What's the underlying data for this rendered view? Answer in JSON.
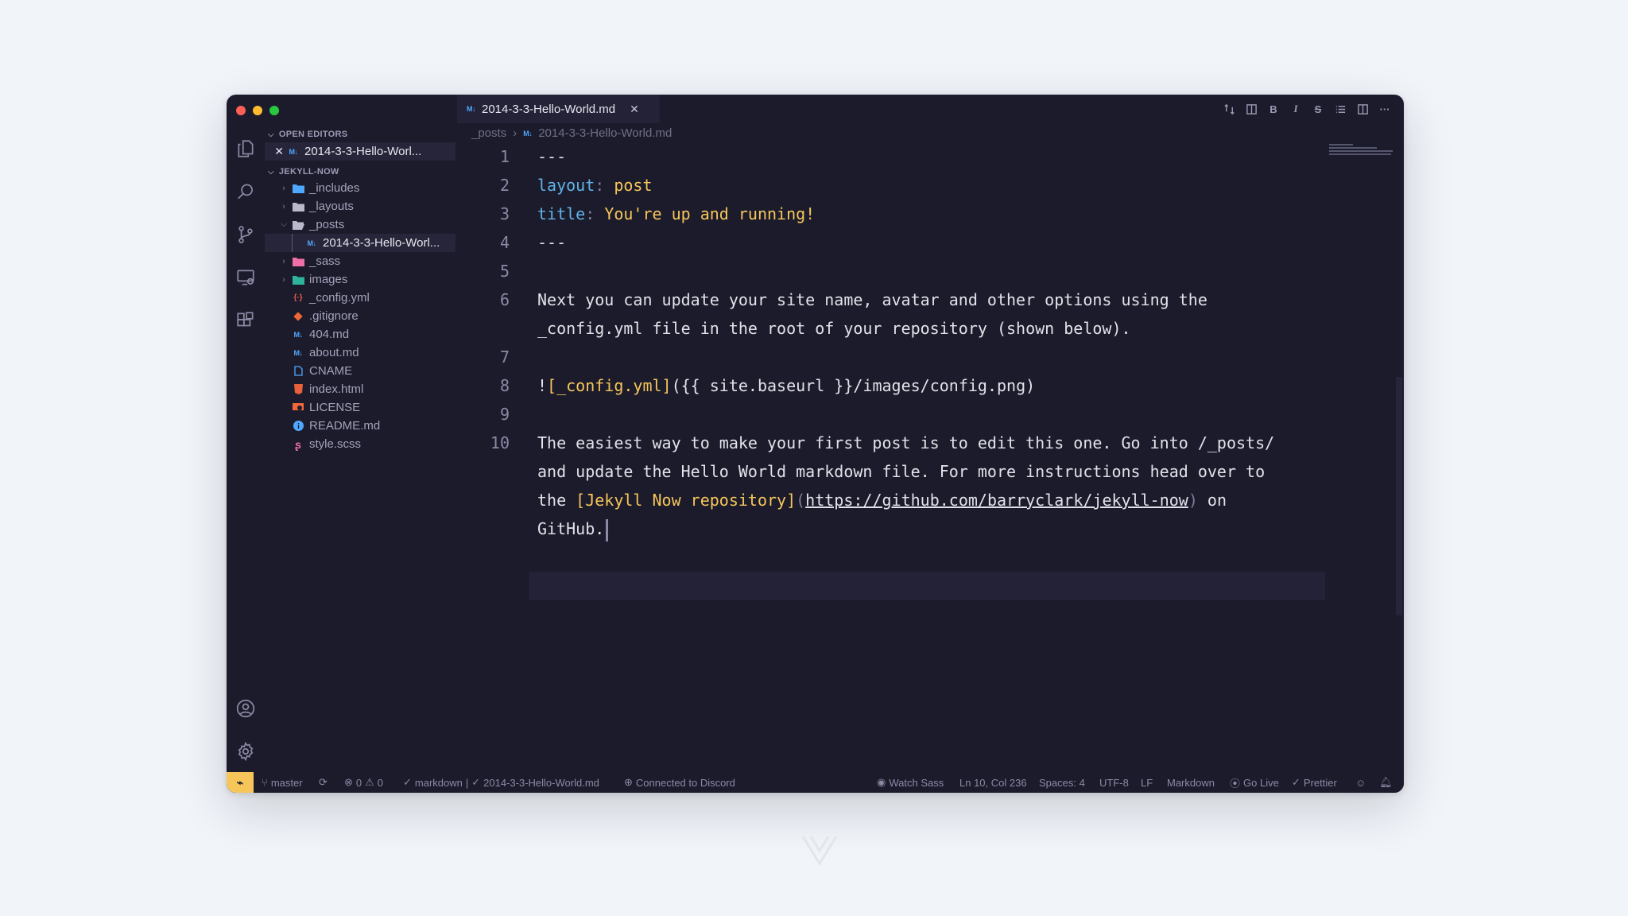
{
  "sidebar": {
    "more_label": "···",
    "open_editors": {
      "title": "OPEN EDITORS",
      "items": [
        {
          "label": "2014-3-3-Hello-Worl..."
        }
      ]
    },
    "project": {
      "title": "JEKYLL-NOW",
      "items": [
        {
          "label": "_includes"
        },
        {
          "label": "_layouts"
        },
        {
          "label": "_posts"
        },
        {
          "label": "2014-3-3-Hello-Worl..."
        },
        {
          "label": "_sass"
        },
        {
          "label": "images"
        },
        {
          "label": "_config.yml"
        },
        {
          "label": ".gitignore"
        },
        {
          "label": "404.md"
        },
        {
          "label": "about.md"
        },
        {
          "label": "CNAME"
        },
        {
          "label": "index.html"
        },
        {
          "label": "LICENSE"
        },
        {
          "label": "README.md"
        },
        {
          "label": "style.scss"
        }
      ]
    }
  },
  "tab": {
    "label": "2014-3-3-Hello-World.md",
    "badge": "M↓"
  },
  "toolbar": {
    "bold": "B",
    "italic": "I",
    "strike": "S",
    "more": "···"
  },
  "breadcrumb": {
    "folder": "_posts",
    "sep": "›",
    "file": "2014-3-3-Hello-World.md"
  },
  "editor": {
    "line_numbers": [
      "1",
      "2",
      "3",
      "4",
      "5",
      "6",
      "7",
      "8",
      "9",
      "10"
    ],
    "l1": "---",
    "l2_key": "layout",
    "l2_colon": ": ",
    "l2_val": "post",
    "l3_key": "title",
    "l3_colon": ": ",
    "l3_val": "You're up and running!",
    "l4": "---",
    "l6a": "Next you can update your site name, avatar and other options using the",
    "l6b": "_config.yml file in the root of your repository (shown below).",
    "l8_bang": "!",
    "l8_alt": "[_config.yml]",
    "l8_rest": "({{ site.baseurl }}/images/config.png)",
    "l10a": "The easiest way to make your first post is to edit this one. Go into /_posts/",
    "l10b": "and update the Hello World markdown file. For more instructions head over to",
    "l10c_pre": "the ",
    "l10c_link": "[Jekyll Now repository]",
    "l10c_po": "(",
    "l10c_url": "https://github.com/barryclark/jekyll-now",
    "l10c_pc": ")",
    "l10c_post": " on",
    "l10d": "GitHub."
  },
  "statusbar": {
    "branch": "master",
    "errors": "0",
    "warnings": "0",
    "lint": "markdown",
    "file": "2014-3-3-Hello-World.md",
    "discord": "Connected to Discord",
    "watch_sass": "Watch Sass",
    "position": "Ln 10, Col 236",
    "spaces": "Spaces: 4",
    "encoding": "UTF-8",
    "eol": "LF",
    "language": "Markdown",
    "golive": "Go Live",
    "prettier": "Prettier"
  },
  "colors": {
    "background": "#f1f4f9",
    "window": "#1c1b2b",
    "accent_yellow": "#f6c65b",
    "key_blue": "#5fb3e8"
  }
}
